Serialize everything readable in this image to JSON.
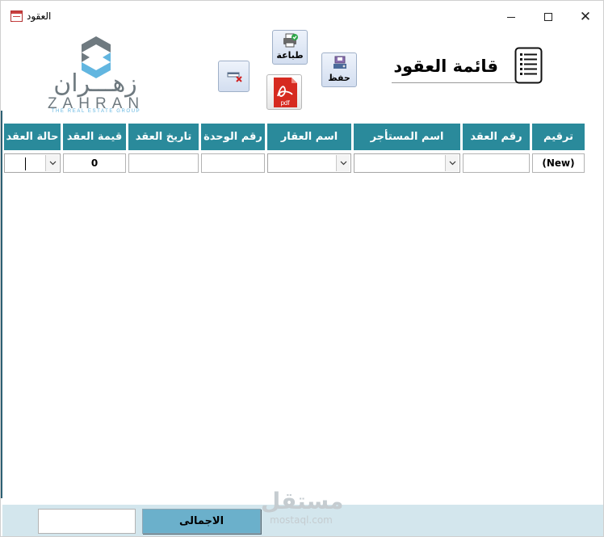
{
  "window": {
    "title": "العقود",
    "minimize_label": "",
    "maximize_label": "",
    "close_label": "✕"
  },
  "logo": {
    "arabic": "زهـــران",
    "latin": "ZAHRAN",
    "tagline": "THE REAL ESTATE GROUP"
  },
  "toolbar": {
    "print_label": "طباعة",
    "save_label": "حفظ",
    "pdf_label": "pdf"
  },
  "form": {
    "title": "قائمة العقود"
  },
  "columns": [
    "ترقيم",
    "رقم العقد",
    "اسم المستأجر",
    "اسم العقار",
    "رقم الوحدة",
    "تاريخ العقد",
    "قيمة العقد",
    "حالة العقد"
  ],
  "row": {
    "serial": "(New)",
    "contract_number": "",
    "tenant_name": "",
    "property_name": "",
    "unit_number": "",
    "contract_date": "",
    "contract_value": "0",
    "contract_status": ""
  },
  "footer": {
    "total_label": "الاجمالى",
    "total_value": ""
  },
  "watermark": {
    "arabic": "مستقل",
    "latin": "mostaql.com"
  },
  "colors": {
    "header_bg": "#2a8a9b",
    "footer_bg": "#d3e6ed",
    "total_button": "#6bb0cb"
  }
}
